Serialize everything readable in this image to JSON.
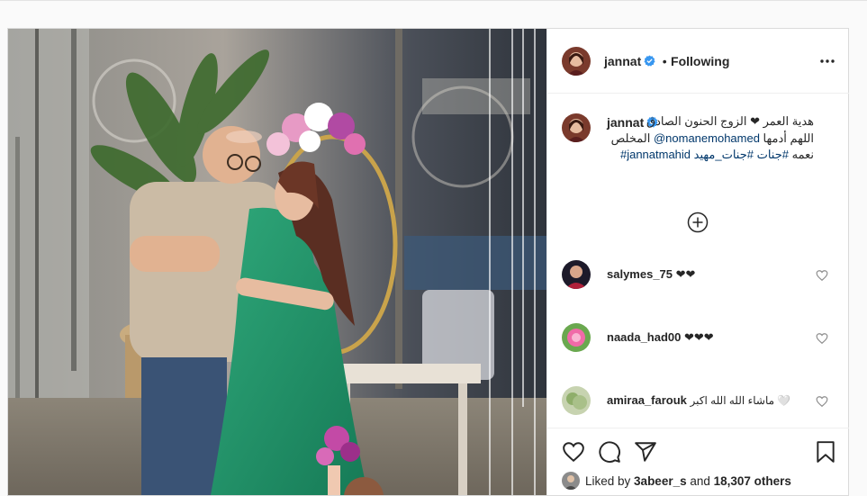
{
  "post": {
    "username": "jannat",
    "follow_status": "Following",
    "caption": {
      "username": "jannat",
      "line1": "هدية العمر ❤ الزوج الحنون الصادق",
      "line2_pre": "اللهم أدمها ",
      "mention": "@nomanemohamed",
      "line2_post": " المخلص",
      "line3_pre": "نعمه ",
      "tag1": "#جنات",
      "tag2": "#جنات_مهيد",
      "tag3": "#jannatmahid"
    },
    "comments": [
      {
        "username": "salymes_75",
        "text": "❤❤"
      },
      {
        "username": "naada_had00",
        "text": "❤❤❤"
      },
      {
        "username": "amiraa_farouk",
        "text": "ماشاء الله الله اكبر 🤍"
      }
    ],
    "likes": {
      "prefix": "Liked by ",
      "user": "3abeer_s",
      "middle": " and ",
      "count": "18,307 others"
    }
  },
  "colors": {
    "accent": "#0095f6",
    "link": "#00376b",
    "border": "#dbdbdb"
  },
  "icons": [
    "verified-badge-icon",
    "more-options-icon",
    "load-more-comments-icon",
    "like-heart-icon",
    "comment-icon",
    "share-icon",
    "save-bookmark-icon"
  ]
}
